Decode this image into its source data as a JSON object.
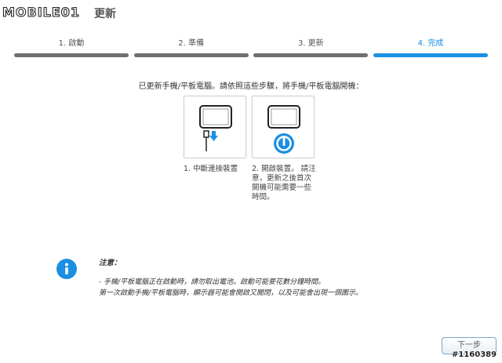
{
  "header": {
    "logo_text": "MOBILE01",
    "title": "更新"
  },
  "steps": [
    {
      "label": "1. 啟動",
      "active": false
    },
    {
      "label": "2. 準備",
      "active": false
    },
    {
      "label": "3. 更新",
      "active": false
    },
    {
      "label": "4. 完成",
      "active": true
    }
  ],
  "instruction": "已更新手機/平板電腦。請依照這些步驟，將手機/平板電腦開機：",
  "panels": [
    {
      "icon": "disconnect-device-icon",
      "caption": "1. 中斷連接裝置"
    },
    {
      "icon": "power-on-device-icon",
      "caption": "2. 開啟裝置。 請注意，更新之後首次開機可能需要一些時間。"
    }
  ],
  "note": {
    "icon": "info-icon",
    "title": "注意：",
    "lines": [
      "- 手機/平板電腦正在啟動時，請勿取出電池。啟動可能要花數分鐘時間。",
      "第一次啟動手機/平板電腦時，顯示器可能會開啟又關閉，以及可能會出現一個圖示。"
    ]
  },
  "buttons": {
    "next_label": "下一步"
  },
  "watermark": {
    "id_text": "#1160389"
  },
  "colors": {
    "accent": "#1a8fe3",
    "inactive_bar": "#6f6f6f"
  }
}
